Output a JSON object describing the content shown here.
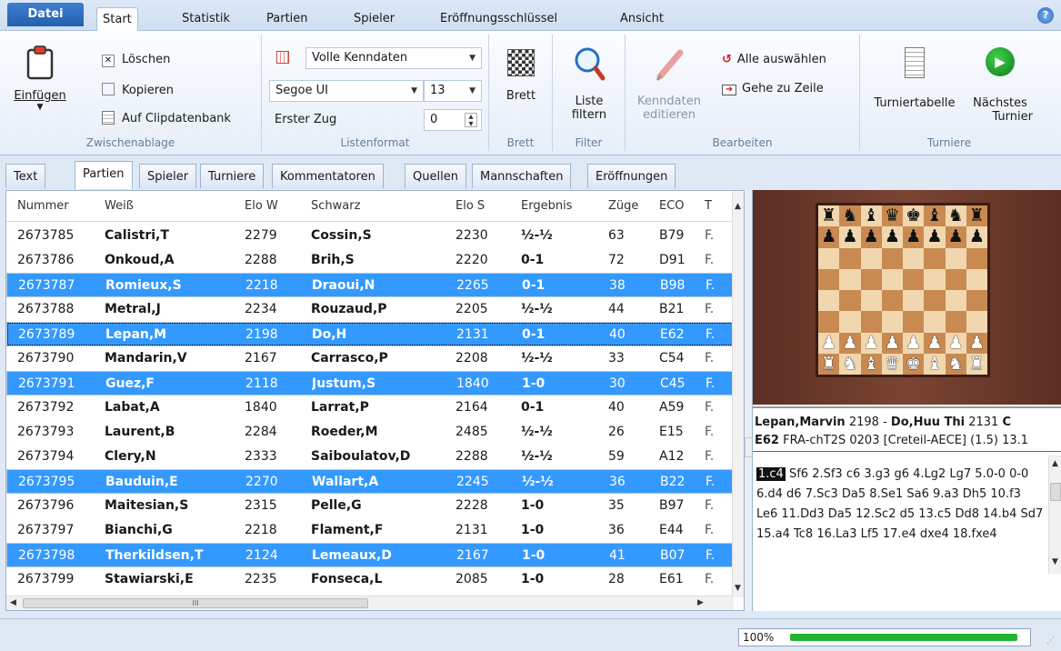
{
  "ribbon_tabs": {
    "file": "Datei",
    "start": "Start",
    "statistik": "Statistik",
    "partien": "Partien",
    "spieler": "Spieler",
    "eroeffnung": "Eröffnungsschlüssel",
    "ansicht": "Ansicht",
    "help": "?"
  },
  "clipboard": {
    "paste": "Einfügen",
    "delete": "Löschen",
    "copy": "Kopieren",
    "clipdb": "Auf Clipdatenbank",
    "label": "Zwischenablage"
  },
  "listformat": {
    "mode": "Volle Kenndaten",
    "font": "Segoe UI",
    "size": "13",
    "first_move_label": "Erster Zug",
    "first_move_value": "0",
    "label": "Listenformat"
  },
  "brett": {
    "button": "Brett",
    "label": "Brett"
  },
  "filter": {
    "button_line1": "Liste",
    "button_line2": "filtern",
    "label": "Filter"
  },
  "edit": {
    "kenndaten_line1": "Kenndaten",
    "kenndaten_line2": "editieren",
    "select_all": "Alle auswählen",
    "goto_row": "Gehe zu Zeile",
    "label": "Bearbeiten"
  },
  "turniere": {
    "table": "Turniertabelle",
    "next_line1": "Nächstes",
    "next_line2": "Turnier",
    "label": "Turniere"
  },
  "doc_tabs": [
    "Text",
    "Partien",
    "Spieler",
    "Turniere",
    "Kommentatoren",
    "Quellen",
    "Mannschaften",
    "Eröffnungen"
  ],
  "columns": {
    "nummer": "Nummer",
    "weiss": "Weiß",
    "elo_w": "Elo W",
    "schwarz": "Schwarz",
    "elo_s": "Elo S",
    "ergebnis": "Ergebnis",
    "zuege": "Züge",
    "eco": "ECO",
    "t": "T"
  },
  "rows": [
    {
      "nr": "2673785",
      "w": "Calistri,T",
      "ew": "2279",
      "s": "Cossin,S",
      "es": "2230",
      "r": "½-½",
      "z": "63",
      "eco": "B79",
      "t": "F."
    },
    {
      "nr": "2673786",
      "w": "Onkoud,A",
      "ew": "2288",
      "s": "Brih,S",
      "es": "2220",
      "r": "0-1",
      "z": "72",
      "eco": "D91",
      "t": "F."
    },
    {
      "nr": "2673787",
      "w": "Romieux,S",
      "ew": "2218",
      "s": "Draoui,N",
      "es": "2265",
      "r": "0-1",
      "z": "38",
      "eco": "B98",
      "t": "F."
    },
    {
      "nr": "2673788",
      "w": "Metral,J",
      "ew": "2234",
      "s": "Rouzaud,P",
      "es": "2205",
      "r": "½-½",
      "z": "44",
      "eco": "B21",
      "t": "F."
    },
    {
      "nr": "2673789",
      "w": "Lepan,M",
      "ew": "2198",
      "s": "Do,H",
      "es": "2131",
      "r": "0-1",
      "z": "40",
      "eco": "E62",
      "t": "F."
    },
    {
      "nr": "2673790",
      "w": "Mandarin,V",
      "ew": "2167",
      "s": "Carrasco,P",
      "es": "2208",
      "r": "½-½",
      "z": "33",
      "eco": "C54",
      "t": "F."
    },
    {
      "nr": "2673791",
      "w": "Guez,F",
      "ew": "2118",
      "s": "Justum,S",
      "es": "1840",
      "r": "1-0",
      "z": "30",
      "eco": "C45",
      "t": "F."
    },
    {
      "nr": "2673792",
      "w": "Labat,A",
      "ew": "1840",
      "s": "Larrat,P",
      "es": "2164",
      "r": "0-1",
      "z": "40",
      "eco": "A59",
      "t": "F."
    },
    {
      "nr": "2673793",
      "w": "Laurent,B",
      "ew": "2284",
      "s": "Roeder,M",
      "es": "2485",
      "r": "½-½",
      "z": "26",
      "eco": "E15",
      "t": "F."
    },
    {
      "nr": "2673794",
      "w": "Clery,N",
      "ew": "2333",
      "s": "Saiboulatov,D",
      "es": "2288",
      "r": "½-½",
      "z": "59",
      "eco": "A12",
      "t": "F."
    },
    {
      "nr": "2673795",
      "w": "Bauduin,E",
      "ew": "2270",
      "s": "Wallart,A",
      "es": "2245",
      "r": "½-½",
      "z": "36",
      "eco": "B22",
      "t": "F."
    },
    {
      "nr": "2673796",
      "w": "Maitesian,S",
      "ew": "2315",
      "s": "Pelle,G",
      "es": "2228",
      "r": "1-0",
      "z": "35",
      "eco": "B97",
      "t": "F."
    },
    {
      "nr": "2673797",
      "w": "Bianchi,G",
      "ew": "2218",
      "s": "Flament,F",
      "es": "2131",
      "r": "1-0",
      "z": "36",
      "eco": "E44",
      "t": "F."
    },
    {
      "nr": "2673798",
      "w": "Therkildsen,T",
      "ew": "2124",
      "s": "Lemeaux,D",
      "es": "2167",
      "r": "1-0",
      "z": "41",
      "eco": "B07",
      "t": "F."
    },
    {
      "nr": "2673799",
      "w": "Stawiarski,E",
      "ew": "2235",
      "s": "Fonseca,L",
      "es": "2085",
      "r": "1-0",
      "z": "28",
      "eco": "E61",
      "t": "F."
    }
  ],
  "selected_rows": [
    2,
    4,
    6,
    10,
    13
  ],
  "focused_row": 4,
  "scroll_thumb": "III",
  "game": {
    "white": "Lepan,Marvin",
    "white_elo": "2198",
    "sep": "-",
    "black": "Do,Huu Thi",
    "black_elo": "2131",
    "tail": "C",
    "eco": "E62",
    "event": "FRA-chT2S 0203 [Creteil-AECE] (1.5) 13.1"
  },
  "notation": {
    "current": "1.c4",
    "text": "Sf6 2.Sf3 c6 3.g3 g6 4.Lg2 Lg7 5.0-0 0-0 6.d4 d6 7.Sc3 Da5 8.Se1 Sa6 9.a3 Dh5 10.f3 Le6 11.Dd3 Da5 12.Sc2 d5 13.c5 Dd8 14.b4 Sd7 15.a4 Tc8 16.La3 Lf5 17.e4 dxe4 18.fxe4"
  },
  "board": [
    "rnbqkbnr",
    "pppppppp",
    "........",
    "........",
    "........",
    "........",
    "PPPPPPPP",
    "RNBQKBNR"
  ],
  "status": {
    "percent_label": "100%",
    "progress": 1.0
  },
  "colors": {
    "selection": "#3399ff",
    "progress": "#21b331",
    "file_tab": "#2d6ebf"
  }
}
